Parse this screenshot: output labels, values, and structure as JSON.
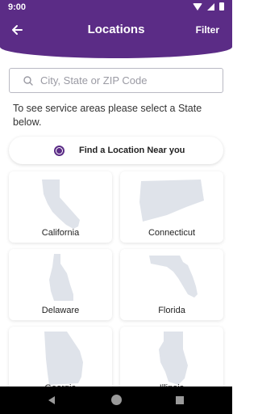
{
  "status_bar": {
    "time": "9:00"
  },
  "header": {
    "title": "Locations",
    "filter_label": "Filter",
    "back_icon": "arrow-left-icon"
  },
  "search": {
    "placeholder": "City, State or ZIP Code",
    "value": ""
  },
  "helper_text": "To see service areas please select a State below.",
  "near_me": {
    "label": "Find a Location Near you",
    "selected": true
  },
  "states": [
    {
      "name": "California"
    },
    {
      "name": "Connecticut"
    },
    {
      "name": "Delaware"
    },
    {
      "name": "Florida"
    },
    {
      "name": "Georgia"
    },
    {
      "name": "Illinois"
    }
  ],
  "colors": {
    "brand": "#5b2c86",
    "map_fill": "#dfe3ea"
  }
}
